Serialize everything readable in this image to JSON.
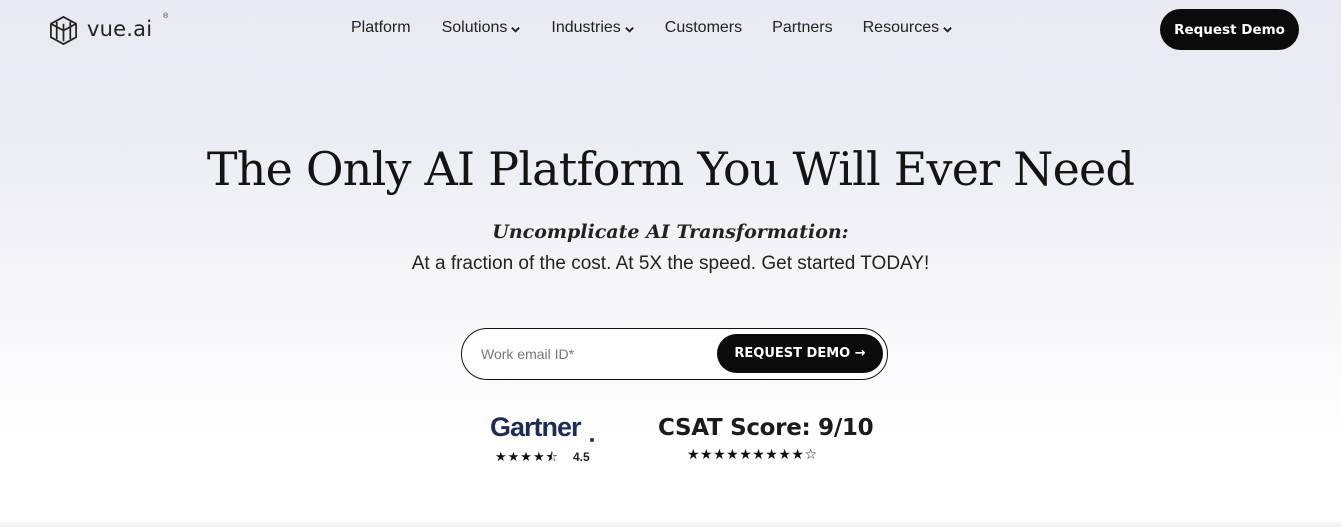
{
  "brand": {
    "name": "vue.ai",
    "registered_mark": "®"
  },
  "nav": {
    "items": [
      {
        "label": "Platform",
        "has_dropdown": false
      },
      {
        "label": "Solutions",
        "has_dropdown": true
      },
      {
        "label": "Industries",
        "has_dropdown": true
      },
      {
        "label": "Customers",
        "has_dropdown": false
      },
      {
        "label": "Partners",
        "has_dropdown": false
      },
      {
        "label": "Resources",
        "has_dropdown": true
      }
    ],
    "cta_label": "Request Demo"
  },
  "hero": {
    "title": "The Only AI Platform You Will Ever Need",
    "subtitle_emphasis": "Uncomplicate AI Transformation:",
    "subtitle": "At a fraction of the cost. At 5X the speed. Get started TODAY!"
  },
  "form": {
    "email_placeholder": "Work email ID*",
    "email_value": "",
    "submit_label": "REQUEST DEMO →"
  },
  "ratings": {
    "gartner": {
      "logo_text": "Gartner",
      "stars": "★★★★⯪",
      "score": "4.5"
    },
    "csat": {
      "label": "CSAT Score: 9/10",
      "stars": "★★★★★★★★★☆"
    }
  },
  "colors": {
    "accent": "#0b0b0b",
    "gartner_navy": "#1f2d55",
    "background_top": "#e9e9f3",
    "background_bottom": "#ffffff"
  }
}
